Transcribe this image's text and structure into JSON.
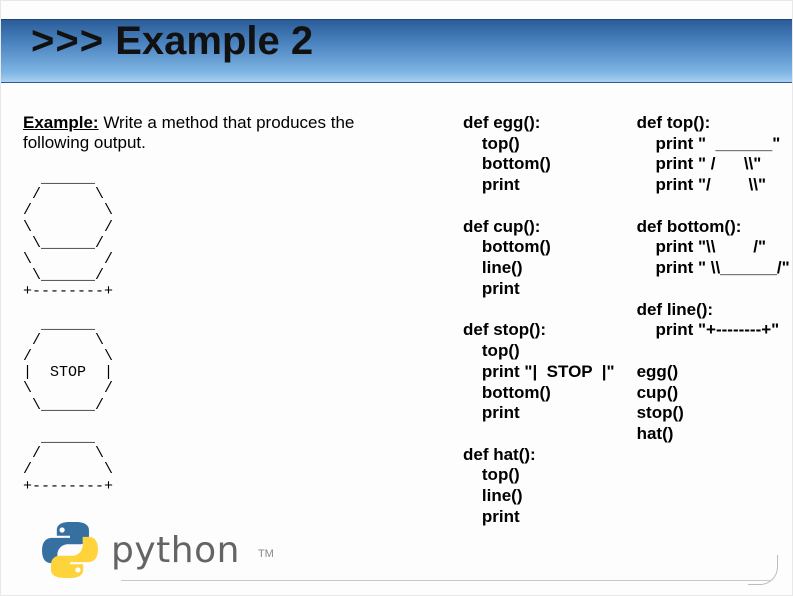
{
  "title": {
    "prompt": ">>>",
    "text": "Example 2"
  },
  "example": {
    "lead": "Example:",
    "rest": " Write a method that produces the following output."
  },
  "ascii": "  ______\n /      \\\n/        \\\n\\        /\n \\______/\n\\        /\n \\______/\n+--------+\n\n  ______\n /      \\\n/        \\\n|  STOP  |\n\\        /\n \\______/\n\n  ______\n /      \\\n/        \\\n+--------+",
  "code_col1": {
    "egg_def": "def egg():",
    "egg_body": "    top()\n    bottom()\n    print",
    "cup_def": "def cup():",
    "cup_body": "    bottom()\n    line()\n    print",
    "stop_def": "def stop():",
    "stop_body": "    top()\n    print \"|  STOP  |\"\n    bottom()\n    print",
    "hat_def": "def hat():",
    "hat_body": "    top()\n    line()\n    print"
  },
  "code_col2": {
    "top_def": "def top():",
    "top_body": "    print \"  ______\"\n    print \" /      \\\\\"\n    print \"/        \\\\\"",
    "bottom_def": "def bottom():",
    "bottom_body": "    print \"\\\\        /\"\n    print \" \\\\______/\"",
    "line_def": "def line():",
    "line_body": "    print \"+--------+\"",
    "calls": "egg()\ncup()\nstop()\nhat()"
  },
  "logo": {
    "word": "python",
    "tm": "TM"
  }
}
